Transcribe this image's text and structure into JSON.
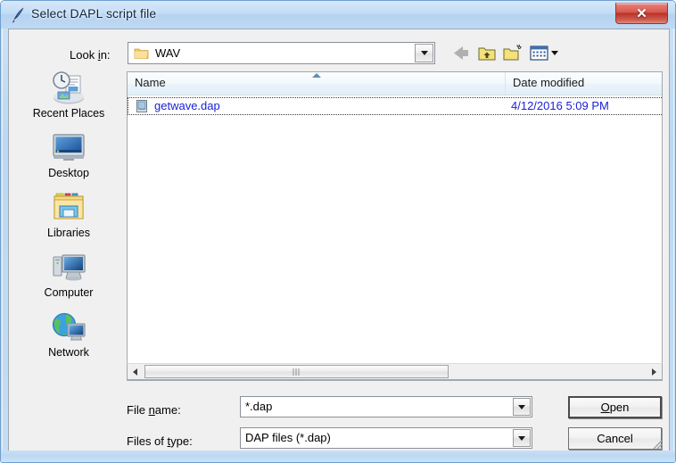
{
  "window": {
    "title": "Select DAPL script file",
    "app_icon": "quill-pen-icon",
    "close_label": "✕"
  },
  "toolbar": {
    "lookin_label_pre": "Look ",
    "lookin_label_accel": "i",
    "lookin_label_post": "n:",
    "lookin_value": "WAV",
    "lookin_dropdown_icon": "chevron-down-icon",
    "buttons": [
      {
        "name": "back-button",
        "icon": "back-arrow-icon",
        "enabled": false
      },
      {
        "name": "up-one-level-button",
        "icon": "folder-up-arrow-icon",
        "enabled": true
      },
      {
        "name": "new-folder-button",
        "icon": "new-folder-icon",
        "enabled": true
      },
      {
        "name": "views-button",
        "icon": "views-grid-icon",
        "enabled": true
      }
    ]
  },
  "places": {
    "items": [
      {
        "label": "Recent Places",
        "icon": "recent-places-icon"
      },
      {
        "label": "Desktop",
        "icon": "desktop-monitor-icon"
      },
      {
        "label": "Libraries",
        "icon": "libraries-folder-icon"
      },
      {
        "label": "Computer",
        "icon": "computer-icon"
      },
      {
        "label": "Network",
        "icon": "network-globe-icon"
      }
    ]
  },
  "filelist": {
    "columns": [
      {
        "label": "Name",
        "sorted": "ascending",
        "sort_icon": "sort-ascending-icon"
      },
      {
        "label": "Date modified",
        "sorted": "none"
      }
    ],
    "rows": [
      {
        "name": "getwave.dap",
        "date_modified": "4/12/2016 5:09 PM",
        "icon": "script-file-icon",
        "focused": true
      }
    ]
  },
  "scrollbar": {
    "left_icon": "scroll-left-arrow-icon",
    "right_icon": "scroll-right-arrow-icon",
    "grip_icon": "scroll-thumb-grip-icon"
  },
  "form": {
    "filename_label_pre": "File ",
    "filename_label_accel": "n",
    "filename_label_post": "ame:",
    "filename_value": "*.dap",
    "filetype_label_pre": "Files of ",
    "filetype_label_accel": "t",
    "filetype_label_post": "ype:",
    "filetype_value": "DAP files (*.dap)",
    "dropdown_icon": "chevron-down-icon"
  },
  "buttons": {
    "open_pre": "",
    "open_accel": "O",
    "open_post": "pen",
    "cancel_label": "Cancel"
  },
  "colors": {
    "titlebar": "#b4d2f0",
    "close_button": "#bb3127",
    "dialog_bg": "#f0f0f0",
    "link_text": "#1d21d6",
    "sort_arrow": "#5a8fb5"
  }
}
